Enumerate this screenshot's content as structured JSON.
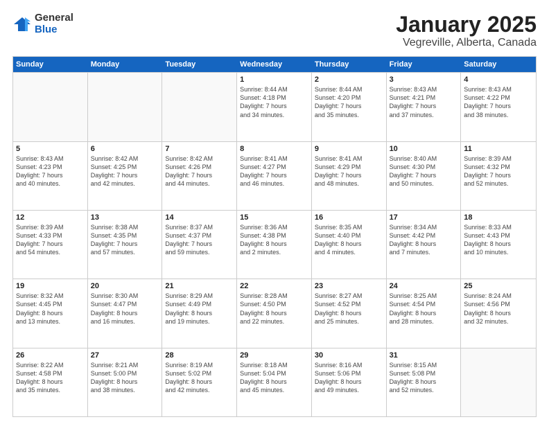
{
  "logo": {
    "general": "General",
    "blue": "Blue"
  },
  "title": "January 2025",
  "subtitle": "Vegreville, Alberta, Canada",
  "days": [
    "Sunday",
    "Monday",
    "Tuesday",
    "Wednesday",
    "Thursday",
    "Friday",
    "Saturday"
  ],
  "weeks": [
    [
      {
        "day": "",
        "info": ""
      },
      {
        "day": "",
        "info": ""
      },
      {
        "day": "",
        "info": ""
      },
      {
        "day": "1",
        "info": "Sunrise: 8:44 AM\nSunset: 4:18 PM\nDaylight: 7 hours\nand 34 minutes."
      },
      {
        "day": "2",
        "info": "Sunrise: 8:44 AM\nSunset: 4:20 PM\nDaylight: 7 hours\nand 35 minutes."
      },
      {
        "day": "3",
        "info": "Sunrise: 8:43 AM\nSunset: 4:21 PM\nDaylight: 7 hours\nand 37 minutes."
      },
      {
        "day": "4",
        "info": "Sunrise: 8:43 AM\nSunset: 4:22 PM\nDaylight: 7 hours\nand 38 minutes."
      }
    ],
    [
      {
        "day": "5",
        "info": "Sunrise: 8:43 AM\nSunset: 4:23 PM\nDaylight: 7 hours\nand 40 minutes."
      },
      {
        "day": "6",
        "info": "Sunrise: 8:42 AM\nSunset: 4:25 PM\nDaylight: 7 hours\nand 42 minutes."
      },
      {
        "day": "7",
        "info": "Sunrise: 8:42 AM\nSunset: 4:26 PM\nDaylight: 7 hours\nand 44 minutes."
      },
      {
        "day": "8",
        "info": "Sunrise: 8:41 AM\nSunset: 4:27 PM\nDaylight: 7 hours\nand 46 minutes."
      },
      {
        "day": "9",
        "info": "Sunrise: 8:41 AM\nSunset: 4:29 PM\nDaylight: 7 hours\nand 48 minutes."
      },
      {
        "day": "10",
        "info": "Sunrise: 8:40 AM\nSunset: 4:30 PM\nDaylight: 7 hours\nand 50 minutes."
      },
      {
        "day": "11",
        "info": "Sunrise: 8:39 AM\nSunset: 4:32 PM\nDaylight: 7 hours\nand 52 minutes."
      }
    ],
    [
      {
        "day": "12",
        "info": "Sunrise: 8:39 AM\nSunset: 4:33 PM\nDaylight: 7 hours\nand 54 minutes."
      },
      {
        "day": "13",
        "info": "Sunrise: 8:38 AM\nSunset: 4:35 PM\nDaylight: 7 hours\nand 57 minutes."
      },
      {
        "day": "14",
        "info": "Sunrise: 8:37 AM\nSunset: 4:37 PM\nDaylight: 7 hours\nand 59 minutes."
      },
      {
        "day": "15",
        "info": "Sunrise: 8:36 AM\nSunset: 4:38 PM\nDaylight: 8 hours\nand 2 minutes."
      },
      {
        "day": "16",
        "info": "Sunrise: 8:35 AM\nSunset: 4:40 PM\nDaylight: 8 hours\nand 4 minutes."
      },
      {
        "day": "17",
        "info": "Sunrise: 8:34 AM\nSunset: 4:42 PM\nDaylight: 8 hours\nand 7 minutes."
      },
      {
        "day": "18",
        "info": "Sunrise: 8:33 AM\nSunset: 4:43 PM\nDaylight: 8 hours\nand 10 minutes."
      }
    ],
    [
      {
        "day": "19",
        "info": "Sunrise: 8:32 AM\nSunset: 4:45 PM\nDaylight: 8 hours\nand 13 minutes."
      },
      {
        "day": "20",
        "info": "Sunrise: 8:30 AM\nSunset: 4:47 PM\nDaylight: 8 hours\nand 16 minutes."
      },
      {
        "day": "21",
        "info": "Sunrise: 8:29 AM\nSunset: 4:49 PM\nDaylight: 8 hours\nand 19 minutes."
      },
      {
        "day": "22",
        "info": "Sunrise: 8:28 AM\nSunset: 4:50 PM\nDaylight: 8 hours\nand 22 minutes."
      },
      {
        "day": "23",
        "info": "Sunrise: 8:27 AM\nSunset: 4:52 PM\nDaylight: 8 hours\nand 25 minutes."
      },
      {
        "day": "24",
        "info": "Sunrise: 8:25 AM\nSunset: 4:54 PM\nDaylight: 8 hours\nand 28 minutes."
      },
      {
        "day": "25",
        "info": "Sunrise: 8:24 AM\nSunset: 4:56 PM\nDaylight: 8 hours\nand 32 minutes."
      }
    ],
    [
      {
        "day": "26",
        "info": "Sunrise: 8:22 AM\nSunset: 4:58 PM\nDaylight: 8 hours\nand 35 minutes."
      },
      {
        "day": "27",
        "info": "Sunrise: 8:21 AM\nSunset: 5:00 PM\nDaylight: 8 hours\nand 38 minutes."
      },
      {
        "day": "28",
        "info": "Sunrise: 8:19 AM\nSunset: 5:02 PM\nDaylight: 8 hours\nand 42 minutes."
      },
      {
        "day": "29",
        "info": "Sunrise: 8:18 AM\nSunset: 5:04 PM\nDaylight: 8 hours\nand 45 minutes."
      },
      {
        "day": "30",
        "info": "Sunrise: 8:16 AM\nSunset: 5:06 PM\nDaylight: 8 hours\nand 49 minutes."
      },
      {
        "day": "31",
        "info": "Sunrise: 8:15 AM\nSunset: 5:08 PM\nDaylight: 8 hours\nand 52 minutes."
      },
      {
        "day": "",
        "info": ""
      }
    ]
  ]
}
